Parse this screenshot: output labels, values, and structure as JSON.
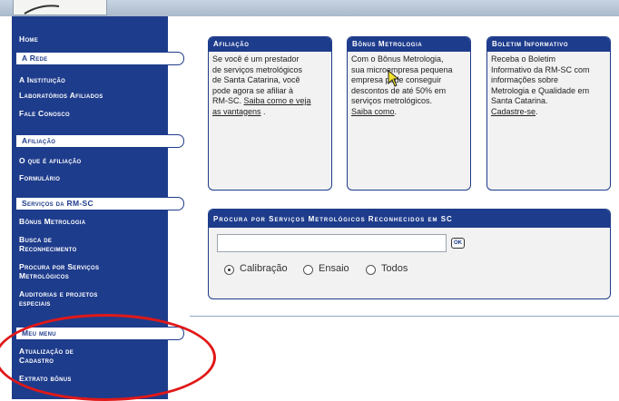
{
  "colors": {
    "primary": "#1e3c8c",
    "panel_bg": "#f2f2f2",
    "annotation": "#e01818"
  },
  "sidebar": {
    "home": "Home",
    "sections": [
      {
        "title": "A Rede",
        "items": [
          "A Instituição",
          "Laboratórios Afiliados",
          "Fale Conosco"
        ]
      },
      {
        "title": "Afiliação",
        "items": [
          "O que é afiliação",
          "Formulário"
        ]
      },
      {
        "title": "Serviços da RM-SC",
        "items": [
          "Bônus Metrologia",
          "Busca de",
          "Reconhecimento",
          "Procura por Serviços",
          "Metrológicos",
          "Auditorias e projetos",
          "especiais"
        ]
      },
      {
        "title": "Meu menu",
        "items": [
          "Atualização de",
          "Cadastro",
          "Extrato bônus"
        ]
      }
    ]
  },
  "panels": [
    {
      "title": "Afiliação",
      "lines": [
        "Se você é um prestador",
        "de serviços metrológicos",
        "de Santa Catarina, você",
        "pode agora se afiliar à"
      ],
      "line5_prefix": "RM-SC. ",
      "link1": "Saiba como e veja",
      "link2": "as vantagens",
      "suffix": " ."
    },
    {
      "title": "Bônus Metrologia",
      "lines": [
        "Com o Bônus Metrologia,",
        "sua microempresa pequena",
        "empresa pode conseguir",
        "descontos de até 50% em",
        "serviços metrológicos."
      ],
      "link": "Saiba como",
      "suffix": "."
    },
    {
      "title": "Boletim Informativo",
      "lines": [
        "Receba o  Boletim",
        "Informativo da RM-SC com",
        "informações sobre",
        "Metrologia e Qualidade em",
        "Santa Catarina."
      ],
      "link": "Cadastre-se",
      "suffix": "."
    }
  ],
  "search": {
    "title": "Procura por Serviços Metrológicos Reconhecidos em SC",
    "value": "",
    "ok_label": "OK",
    "options": [
      "Calibração",
      "Ensaio",
      "Todos"
    ],
    "selected": "Calibração"
  },
  "icons": {
    "cursor": "pointer-cursor-icon",
    "logo": "logo-icon"
  }
}
